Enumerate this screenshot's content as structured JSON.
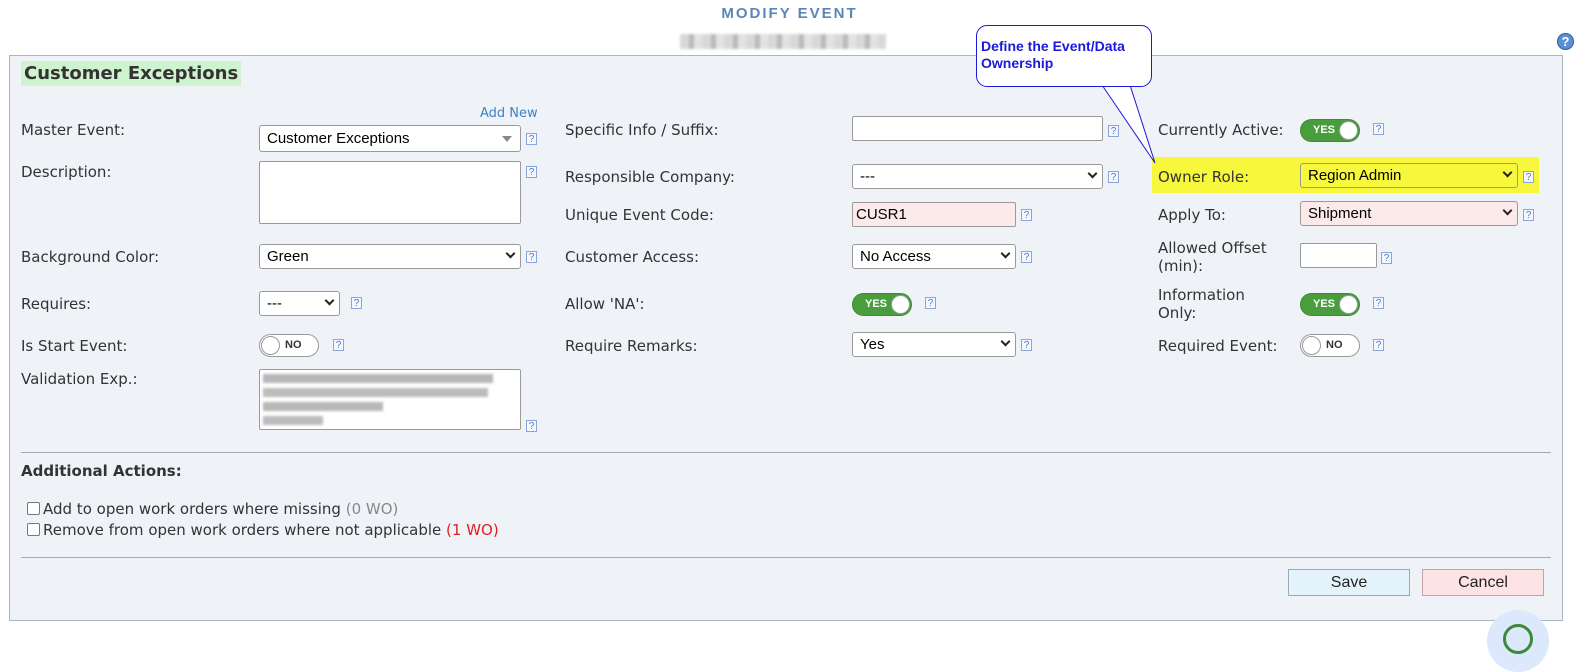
{
  "page": {
    "title": "MODIFY EVENT",
    "help_glyph": "?"
  },
  "form": {
    "section_title": "Customer Exceptions",
    "add_new_link": "Add New",
    "help_glyph": "?",
    "master_event": {
      "label": "Master Event:",
      "value": "Customer Exceptions"
    },
    "description": {
      "label": "Description:",
      "value": ""
    },
    "background_color": {
      "label": "Background Color:",
      "value": "Green"
    },
    "requires": {
      "label": "Requires:",
      "value": "---"
    },
    "is_start_event": {
      "label": "Is Start Event:",
      "state": "NO"
    },
    "validation_exp": {
      "label": "Validation Exp.:"
    },
    "specific_info": {
      "label": "Specific Info / Suffix:",
      "value": ""
    },
    "responsible_company": {
      "label": "Responsible Company:",
      "value": "---"
    },
    "unique_event_code": {
      "label": "Unique Event Code:",
      "value": "CUSR1"
    },
    "customer_access": {
      "label": "Customer Access:",
      "value": "No Access"
    },
    "allow_na": {
      "label": "Allow 'NA':",
      "state": "YES"
    },
    "require_remarks": {
      "label": "Require Remarks:",
      "value": "Yes"
    },
    "currently_active": {
      "label": "Currently Active:",
      "state": "YES"
    },
    "owner_role": {
      "label": "Owner Role:",
      "value": "Region Admin"
    },
    "apply_to": {
      "label": "Apply To:",
      "value": "Shipment"
    },
    "allowed_offset": {
      "label_line1": "Allowed Offset",
      "label_line2": "(min):",
      "value": ""
    },
    "information_only": {
      "label_line1": "Information",
      "label_line2": "Only:",
      "state": "YES"
    },
    "required_event": {
      "label": "Required Event:",
      "state": "NO"
    }
  },
  "callout": {
    "text_line1": "Define the Event/Data",
    "text_line2": "Ownership"
  },
  "additional_actions": {
    "title": "Additional Actions:",
    "add_missing": {
      "label": "Add to open work orders where missing",
      "count": "(0 WO)",
      "checked": false
    },
    "remove_na": {
      "label": "Remove from open work orders where not applicable",
      "count": "(1 WO)",
      "checked": false
    }
  },
  "buttons": {
    "save": "Save",
    "cancel": "Cancel"
  },
  "colors": {
    "title_blue": "#5b86b5",
    "toggle_on": "#4a9d3c",
    "highlight_yellow": "#f7f73b",
    "callout_blue": "#1a1ad8",
    "section_green": "#cdf4cf",
    "count_red": "#e02020"
  }
}
